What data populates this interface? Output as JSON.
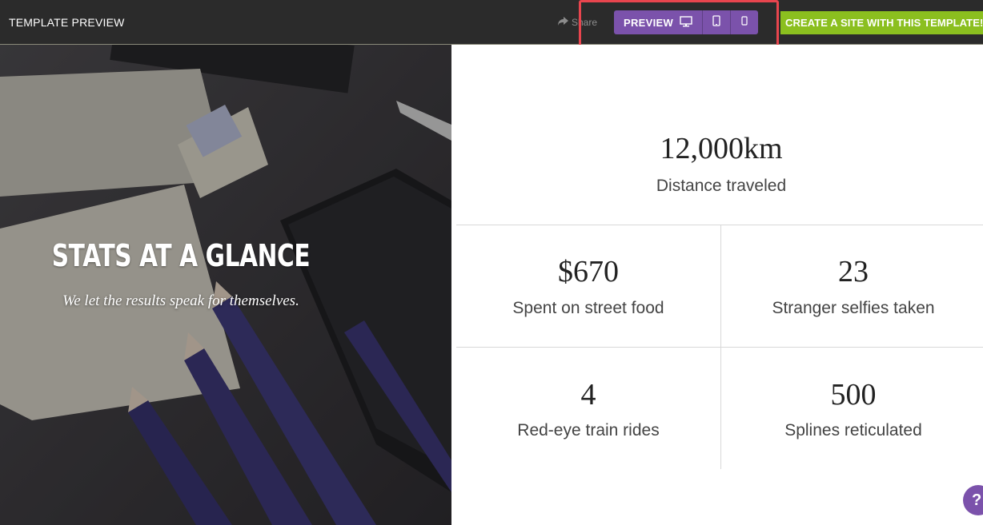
{
  "topbar": {
    "title": "TEMPLATE PREVIEW",
    "share_label": "Share",
    "preview_label": "PREVIEW",
    "create_label": "CREATE A SITE WITH THIS TEMPLATE!"
  },
  "hero": {
    "title": "STATS AT A GLANCE",
    "subtitle": "We let the results speak for themselves."
  },
  "stats": {
    "top": {
      "value": "12,000km",
      "label": "Distance traveled"
    },
    "row1": [
      {
        "value": "$670",
        "label": "Spent on street food"
      },
      {
        "value": "23",
        "label": "Stranger selfies taken"
      }
    ],
    "row2": [
      {
        "value": "4",
        "label": "Red-eye train rides"
      },
      {
        "value": "500",
        "label": "Splines reticulated"
      }
    ]
  },
  "help": {
    "label": "?"
  },
  "colors": {
    "topbar_bg": "#2b2b2b",
    "preview_purple": "#7b52ab",
    "create_green": "#8bbf1f",
    "highlight_red": "#e8454e"
  },
  "icons": {
    "share": "share-arrow-icon",
    "desktop": "desktop-icon",
    "tablet": "tablet-icon",
    "phone": "phone-icon"
  }
}
